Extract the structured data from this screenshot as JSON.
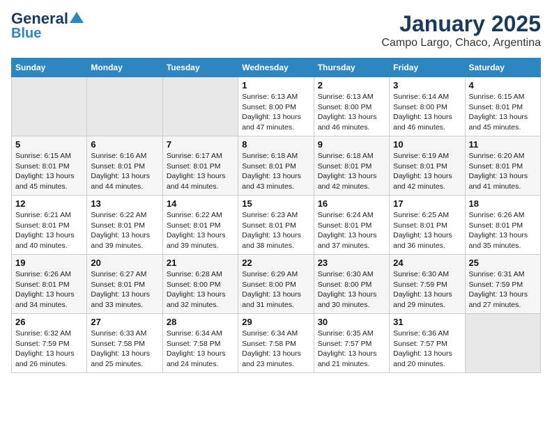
{
  "header": {
    "logo_line1": "General",
    "logo_line2": "Blue",
    "title": "January 2025",
    "subtitle": "Campo Largo, Chaco, Argentina"
  },
  "weekdays": [
    "Sunday",
    "Monday",
    "Tuesday",
    "Wednesday",
    "Thursday",
    "Friday",
    "Saturday"
  ],
  "weeks": [
    [
      {
        "day": "",
        "empty": true
      },
      {
        "day": "",
        "empty": true
      },
      {
        "day": "",
        "empty": true
      },
      {
        "day": "1",
        "sunrise": "6:13 AM",
        "sunset": "8:00 PM",
        "daylight": "13 hours and 47 minutes."
      },
      {
        "day": "2",
        "sunrise": "6:13 AM",
        "sunset": "8:00 PM",
        "daylight": "13 hours and 46 minutes."
      },
      {
        "day": "3",
        "sunrise": "6:14 AM",
        "sunset": "8:00 PM",
        "daylight": "13 hours and 46 minutes."
      },
      {
        "day": "4",
        "sunrise": "6:15 AM",
        "sunset": "8:01 PM",
        "daylight": "13 hours and 45 minutes."
      }
    ],
    [
      {
        "day": "5",
        "sunrise": "6:15 AM",
        "sunset": "8:01 PM",
        "daylight": "13 hours and 45 minutes."
      },
      {
        "day": "6",
        "sunrise": "6:16 AM",
        "sunset": "8:01 PM",
        "daylight": "13 hours and 44 minutes."
      },
      {
        "day": "7",
        "sunrise": "6:17 AM",
        "sunset": "8:01 PM",
        "daylight": "13 hours and 44 minutes."
      },
      {
        "day": "8",
        "sunrise": "6:18 AM",
        "sunset": "8:01 PM",
        "daylight": "13 hours and 43 minutes."
      },
      {
        "day": "9",
        "sunrise": "6:18 AM",
        "sunset": "8:01 PM",
        "daylight": "13 hours and 42 minutes."
      },
      {
        "day": "10",
        "sunrise": "6:19 AM",
        "sunset": "8:01 PM",
        "daylight": "13 hours and 42 minutes."
      },
      {
        "day": "11",
        "sunrise": "6:20 AM",
        "sunset": "8:01 PM",
        "daylight": "13 hours and 41 minutes."
      }
    ],
    [
      {
        "day": "12",
        "sunrise": "6:21 AM",
        "sunset": "8:01 PM",
        "daylight": "13 hours and 40 minutes."
      },
      {
        "day": "13",
        "sunrise": "6:22 AM",
        "sunset": "8:01 PM",
        "daylight": "13 hours and 39 minutes."
      },
      {
        "day": "14",
        "sunrise": "6:22 AM",
        "sunset": "8:01 PM",
        "daylight": "13 hours and 39 minutes."
      },
      {
        "day": "15",
        "sunrise": "6:23 AM",
        "sunset": "8:01 PM",
        "daylight": "13 hours and 38 minutes."
      },
      {
        "day": "16",
        "sunrise": "6:24 AM",
        "sunset": "8:01 PM",
        "daylight": "13 hours and 37 minutes."
      },
      {
        "day": "17",
        "sunrise": "6:25 AM",
        "sunset": "8:01 PM",
        "daylight": "13 hours and 36 minutes."
      },
      {
        "day": "18",
        "sunrise": "6:26 AM",
        "sunset": "8:01 PM",
        "daylight": "13 hours and 35 minutes."
      }
    ],
    [
      {
        "day": "19",
        "sunrise": "6:26 AM",
        "sunset": "8:01 PM",
        "daylight": "13 hours and 34 minutes."
      },
      {
        "day": "20",
        "sunrise": "6:27 AM",
        "sunset": "8:01 PM",
        "daylight": "13 hours and 33 minutes."
      },
      {
        "day": "21",
        "sunrise": "6:28 AM",
        "sunset": "8:00 PM",
        "daylight": "13 hours and 32 minutes."
      },
      {
        "day": "22",
        "sunrise": "6:29 AM",
        "sunset": "8:00 PM",
        "daylight": "13 hours and 31 minutes."
      },
      {
        "day": "23",
        "sunrise": "6:30 AM",
        "sunset": "8:00 PM",
        "daylight": "13 hours and 30 minutes."
      },
      {
        "day": "24",
        "sunrise": "6:30 AM",
        "sunset": "7:59 PM",
        "daylight": "13 hours and 29 minutes."
      },
      {
        "day": "25",
        "sunrise": "6:31 AM",
        "sunset": "7:59 PM",
        "daylight": "13 hours and 27 minutes."
      }
    ],
    [
      {
        "day": "26",
        "sunrise": "6:32 AM",
        "sunset": "7:59 PM",
        "daylight": "13 hours and 26 minutes."
      },
      {
        "day": "27",
        "sunrise": "6:33 AM",
        "sunset": "7:58 PM",
        "daylight": "13 hours and 25 minutes."
      },
      {
        "day": "28",
        "sunrise": "6:34 AM",
        "sunset": "7:58 PM",
        "daylight": "13 hours and 24 minutes."
      },
      {
        "day": "29",
        "sunrise": "6:34 AM",
        "sunset": "7:58 PM",
        "daylight": "13 hours and 23 minutes."
      },
      {
        "day": "30",
        "sunrise": "6:35 AM",
        "sunset": "7:57 PM",
        "daylight": "13 hours and 21 minutes."
      },
      {
        "day": "31",
        "sunrise": "6:36 AM",
        "sunset": "7:57 PM",
        "daylight": "13 hours and 20 minutes."
      },
      {
        "day": "",
        "empty": true
      }
    ]
  ]
}
